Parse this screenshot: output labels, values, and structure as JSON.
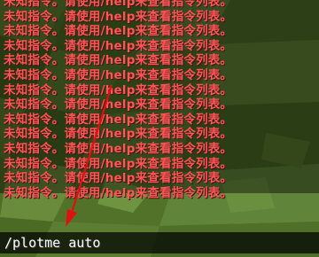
{
  "chat": {
    "lines": [
      "未知指令。请使用/help来查看指令列表。",
      "未知指令。请使用/help来查看指令列表。",
      "未知指令。请使用/help来查看指令列表。",
      "未知指令。请使用/help来查看指令列表。",
      "未知指令。请使用/help来查看指令列表。",
      "未知指令。请使用/help来查看指令列表。",
      "未知指令。请使用/help来查看指令列表。",
      "未知指令。请使用/help来查看指令列表。",
      "未知指令。请使用/help来查看指令列表。",
      "未知指令。请使用/help来查看指令列表。",
      "未知指令。请使用/help来查看指令列表。",
      "未知指令。请使用/help来查看指令列表。",
      "未知指令。请使用/help来查看指令列表。",
      "未知指令。请使用/help来查看指令列表。"
    ],
    "line_color": "#ff5555"
  },
  "input": {
    "value": "/plotme auto"
  },
  "annotation": {
    "arrow_color": "#e01010"
  }
}
